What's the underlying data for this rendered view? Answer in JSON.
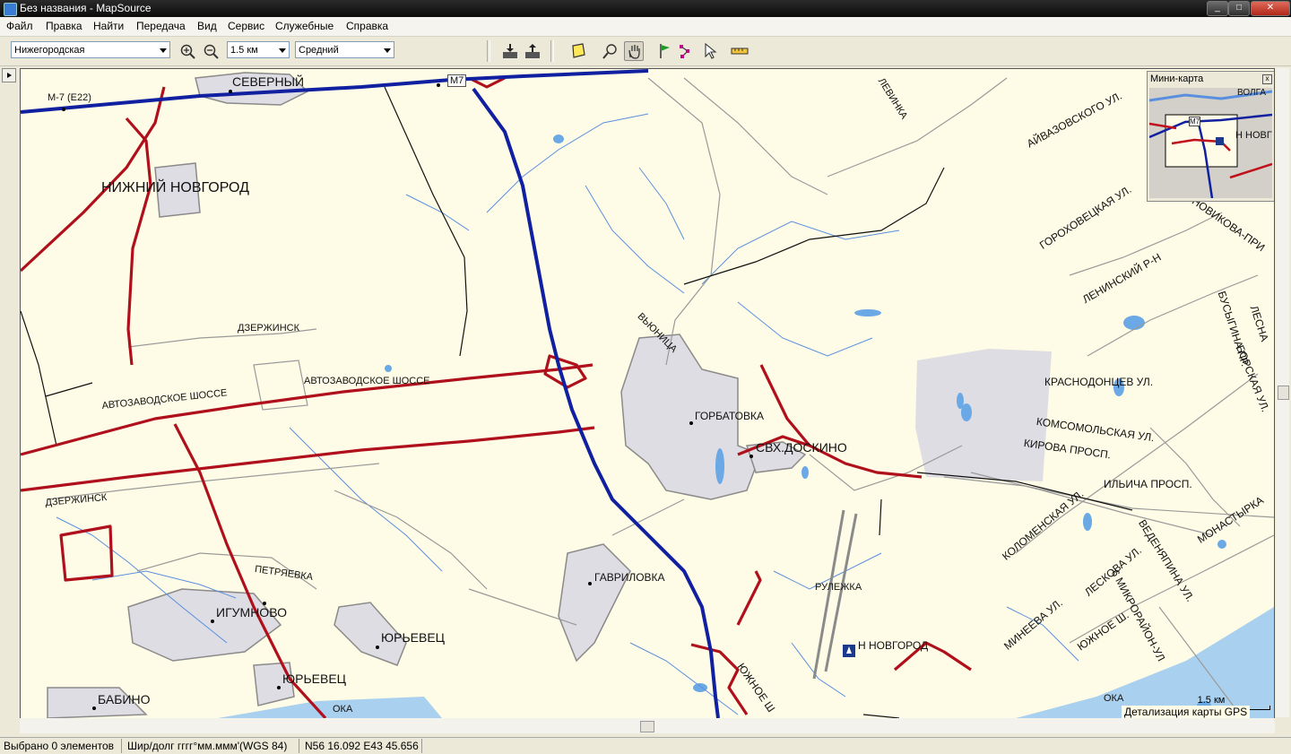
{
  "window": {
    "title": "Без названия - MapSource"
  },
  "menu": [
    "Файл",
    "Правка",
    "Найти",
    "Передача",
    "Вид",
    "Сервис",
    "Служебные",
    "Справка"
  ],
  "toolbar": {
    "map_product": "Нижегородская",
    "zoom_scale": "1.5 км",
    "detail_level": "Средний"
  },
  "minimap": {
    "title": "Мини-карта",
    "labels": {
      "volga": "ВОЛГА",
      "city": "Н НОВГ",
      "road": "М7"
    }
  },
  "map": {
    "labels": {
      "m7_e22": "М-7 (Е22)",
      "m7": "M7",
      "severny": "СЕВЕРНЫЙ",
      "nizhny": "НИЖНИЙ НОВГОРОД",
      "dzerzhinsk1": "ДЗЕРЖИНСК",
      "avtozav1": "АВТОЗАВОДСКОЕ ШОССЕ",
      "avtozav2": "АВТОЗАВОДСКОЕ ШОССЕ",
      "dzerzhinsk2": "ДЗЕРЖИНСК",
      "petryaevka": "ПЕТРЯЕВКА",
      "igumnovo": "ИГУМНОВО",
      "yurevets1": "ЮРЬЕВЕЦ",
      "yurevets2": "ЮРЬЕВЕЦ",
      "babino": "БАБИНО",
      "oka1": "ОКА",
      "vyunitsa": "ВЬЮНИЦА",
      "gorbatovka": "ГОРБАТОВКА",
      "svkh": "СВХ.ДОСКИНО",
      "gavrilovka": "ГАВРИЛОВКА",
      "rulezhka": "РУЛЕЖКА",
      "n_novgorod": "Н НОВГОРОД",
      "yuzhnoe": "ЮЖНОЕ Ш",
      "levinka": "ЛЕВИНКА",
      "ayvazovsk": "АЙВАЗОВСКОГО УЛ.",
      "gorokhov": "ГОРОХОВЕЦКАЯ УЛ.",
      "leninsky": "ЛЕНИНСКИЙ Р-Н",
      "krasnodon": "КРАСНОДОНЦЕВ УЛ.",
      "komsomol": "КОМСОМОЛЬСКАЯ УЛ.",
      "kirova": "КИРОВА ПРОСП.",
      "ilyicha": "ИЛЬИЧА ПРОСП.",
      "kolomen": "КОЛОМЕНСКАЯ УЛ.",
      "leskova": "ЛЕСКОВА УЛ.",
      "vedenyap": "ВЕДЕНЯПИНА УЛ.",
      "monastyrka": "МОНАСТЫРКА",
      "mineeva": "МИНЕЕВА УЛ.",
      "mikrorayon": "6 МИКРОРАЙОН-УЛ",
      "yuzhnoe_sh": "ЮЖНОЕ Ш.",
      "busygina": "БУСЫГИНА ПР.",
      "borskaya": "БОРСКАЯ УЛ.",
      "novikova": "НОВИКОВА-ПРИ",
      "lesnaya": "ЛЕСНА",
      "oka2": "ОКА"
    },
    "scale": "1.5 км",
    "detail_note": "Детализация карты GPS"
  },
  "status": {
    "selected": "Выбрано 0 элементов",
    "format": "Шир/долг гггг°мм.ммм'(WGS 84)",
    "coords": "N56 16.092 E43 45.656"
  }
}
